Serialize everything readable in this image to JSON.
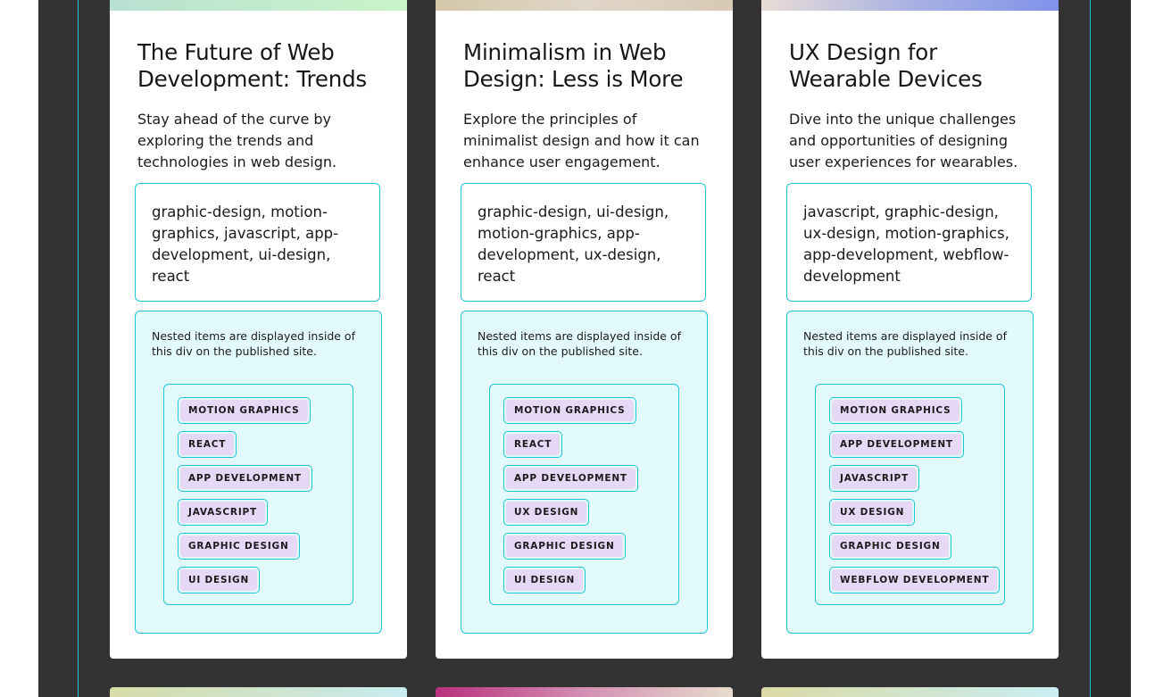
{
  "colors": {
    "canvas": "#333333",
    "guide": "#1fc6d6",
    "chip_bg": "#e6d9f6",
    "nested_bg": "#e3fafd"
  },
  "cards": [
    {
      "title": "The Future of Web Development: Trends",
      "description": "Stay ahead of the curve by exploring the trends and technologies in web design.",
      "tags_text": "graphic-design, motion-graphics, javascript, app-development, ui-design, react",
      "nested_note": "Nested items are displayed inside of this div on the published site.",
      "chips": [
        "MOTION GRAPHICS",
        "REACT",
        "APP DEVELOPMENT",
        "JAVASCRIPT",
        "GRAPHIC DESIGN",
        "UI DESIGN"
      ]
    },
    {
      "title": "Minimalism in Web Design: Less is More",
      "description": "Explore the principles of minimalist design and how it can enhance user engagement.",
      "tags_text": "graphic-design, ui-design, motion-graphics, app-development, ux-design, react",
      "nested_note": "Nested items are displayed inside of this div on the published site.",
      "chips": [
        "MOTION GRAPHICS",
        "REACT",
        "APP DEVELOPMENT",
        "UX DESIGN",
        "GRAPHIC DESIGN",
        "UI DESIGN"
      ]
    },
    {
      "title": "UX Design for Wearable Devices",
      "description": "Dive into the unique challenges and opportunities of designing user experiences for wearables.",
      "tags_text": "javascript, graphic-design, ux-design, motion-graphics, app-development, webflow-development",
      "nested_note": "Nested items are displayed inside of this div on the published site.",
      "chips": [
        "MOTION GRAPHICS",
        "APP DEVELOPMENT",
        "JAVASCRIPT",
        "UX DESIGN",
        "GRAPHIC DESIGN",
        "WEBFLOW DEVELOPMENT"
      ]
    }
  ]
}
